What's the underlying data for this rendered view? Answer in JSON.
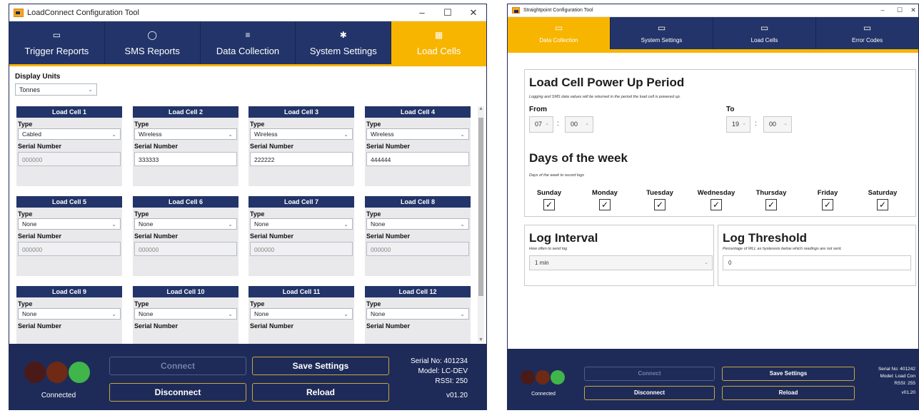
{
  "winA": {
    "title": "LoadConnect Configuration Tool",
    "tabs": [
      {
        "icon": "▭",
        "label": "Trigger Reports"
      },
      {
        "icon": "◯",
        "label": "SMS Reports"
      },
      {
        "icon": "≡",
        "label": "Data Collection"
      },
      {
        "icon": "✱",
        "label": "System Settings"
      },
      {
        "icon": "▦",
        "label": "Load Cells",
        "active": true
      }
    ],
    "display_units_label": "Display Units",
    "display_units_value": "Tonnes",
    "type_label": "Type",
    "serial_label": "Serial Number",
    "cells": [
      {
        "name": "Load Cell 1",
        "type": "Cabled",
        "serial": "000000"
      },
      {
        "name": "Load Cell 2",
        "type": "Wireless",
        "serial": "333333"
      },
      {
        "name": "Load Cell 3",
        "type": "Wireless",
        "serial": "222222"
      },
      {
        "name": "Load Cell 4",
        "type": "Wireless",
        "serial": "444444"
      },
      {
        "name": "Load Cell 5",
        "type": "None",
        "serial": "000000"
      },
      {
        "name": "Load Cell 6",
        "type": "None",
        "serial": "000000"
      },
      {
        "name": "Load Cell 7",
        "type": "None",
        "serial": "000000"
      },
      {
        "name": "Load Cell 8",
        "type": "None",
        "serial": "000000"
      },
      {
        "name": "Load Cell 9",
        "type": "None",
        "serial": ""
      },
      {
        "name": "Load Cell 10",
        "type": "None",
        "serial": ""
      },
      {
        "name": "Load Cell 11",
        "type": "None",
        "serial": ""
      },
      {
        "name": "Load Cell 12",
        "type": "None",
        "serial": ""
      }
    ],
    "footer": {
      "status": "Connected",
      "connect": "Connect",
      "disconnect": "Disconnect",
      "save": "Save Settings",
      "reload": "Reload",
      "serial": "Serial No: 401234",
      "model": "Model: LC-DEV",
      "rssi": "RSSI: 250",
      "version": "v01.20"
    }
  },
  "winB": {
    "title": "Straightpoint Configuration Tool",
    "tabs": [
      {
        "icon": "▭",
        "label": "Data Collection",
        "active": true
      },
      {
        "icon": "▭",
        "label": "System Settings"
      },
      {
        "icon": "▭",
        "label": "Load Cells"
      },
      {
        "icon": "▭",
        "label": "Error Codes"
      }
    ],
    "power": {
      "title": "Load Cell Power Up Period",
      "subtitle": "Logging and SMS data values will be returned in the period the load cell is powered up.",
      "from_label": "From",
      "to_label": "To",
      "from_hour": "07",
      "from_min": "00",
      "to_hour": "19",
      "to_min": "00",
      "colon": ":"
    },
    "days": {
      "title": "Days of the week",
      "subtitle": "Days of the week to record logs",
      "list": [
        "Sunday",
        "Monday",
        "Tuesday",
        "Wednesday",
        "Thursday",
        "Friday",
        "Saturday"
      ],
      "check": "✓"
    },
    "interval": {
      "title": "Log Interval",
      "subtitle": "How often to send log",
      "value": "1 min"
    },
    "threshold": {
      "title": "Log Threshold",
      "subtitle": "Percentage of WLL as hysteresis below which readings are not sent.",
      "value": "0"
    },
    "footer": {
      "status": "Connected",
      "connect": "Connect",
      "disconnect": "Disconnect",
      "save": "Save Settings",
      "reload": "Reload",
      "serial": "Serial No: 401242",
      "model": "Model: Load Con",
      "rssi": "RSSI: 255",
      "version": "v01.20"
    }
  },
  "colors": {
    "navy": "#223469",
    "accent": "#f7b500",
    "status_green": "#3fb54a",
    "status_off": "#5a1f1a"
  }
}
